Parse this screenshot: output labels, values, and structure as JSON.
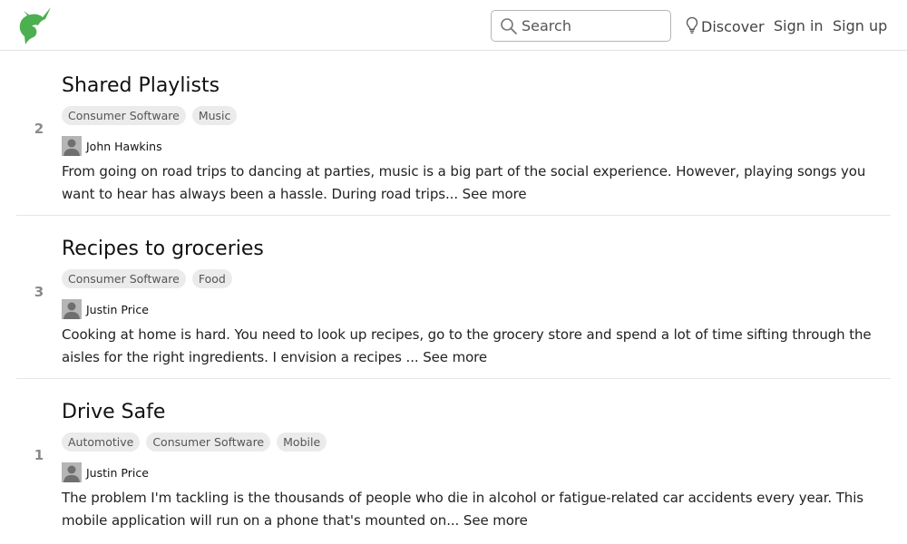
{
  "header": {
    "logo_name": "unicorn-logo",
    "brand_color": "#4caf50",
    "search": {
      "placeholder": "Search",
      "value": ""
    },
    "nav": {
      "discover": "Discover",
      "sign_in": "Sign in",
      "sign_up": "Sign up"
    }
  },
  "feed": {
    "items": [
      {
        "votes": "2",
        "title": "Shared Playlists",
        "tags": [
          "Consumer Software",
          "Music"
        ],
        "author": "John Hawkins",
        "description": "From going on road trips to dancing at parties, music is a big part of the social experience. However, playing songs you want to hear has always been a hassle. During road trips...",
        "see_more": "See more"
      },
      {
        "votes": "3",
        "title": "Recipes to groceries",
        "tags": [
          "Consumer Software",
          "Food"
        ],
        "author": "Justin Price",
        "description": "Cooking at home is hard. You need to look up recipes, go to the grocery store and spend a lot of time sifting through the aisles for the right ingredients. I envision a recipes ...",
        "see_more": "See more"
      },
      {
        "votes": "1",
        "title": "Drive Safe",
        "tags": [
          "Automotive",
          "Consumer Software",
          "Mobile"
        ],
        "author": "Justin Price",
        "description": "The problem I'm tackling is the thousands of people who die in alcohol or fatigue-related car accidents every year. This mobile application will run on a phone that's mounted on...",
        "see_more": "See more"
      }
    ]
  }
}
